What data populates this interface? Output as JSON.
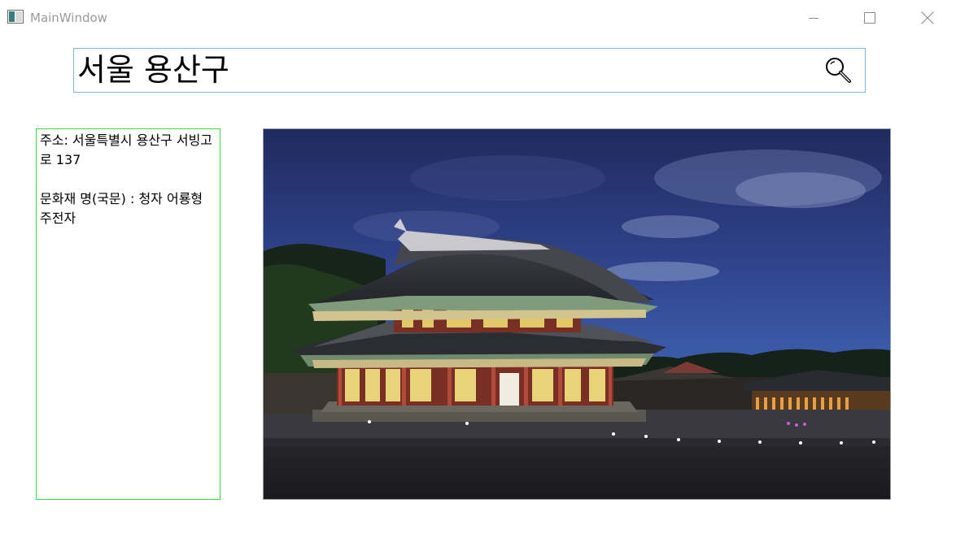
{
  "window": {
    "title": "MainWindow",
    "app_icon": "window-app-icon",
    "controls": {
      "minimize_icon": "minimize-icon",
      "maximize_icon": "maximize-icon",
      "close_icon": "close-icon"
    }
  },
  "search": {
    "value": "서울 용산구",
    "icon": "search-icon",
    "border_color": "#7eb4ea"
  },
  "info": {
    "text": "주소: 서울특별시 용산구 서빙고로 137\n\n문화재 명(국문) : 청자 어룡형 주전자",
    "border_color": "#33e04a"
  },
  "photo": {
    "subject": "palace-photo"
  }
}
